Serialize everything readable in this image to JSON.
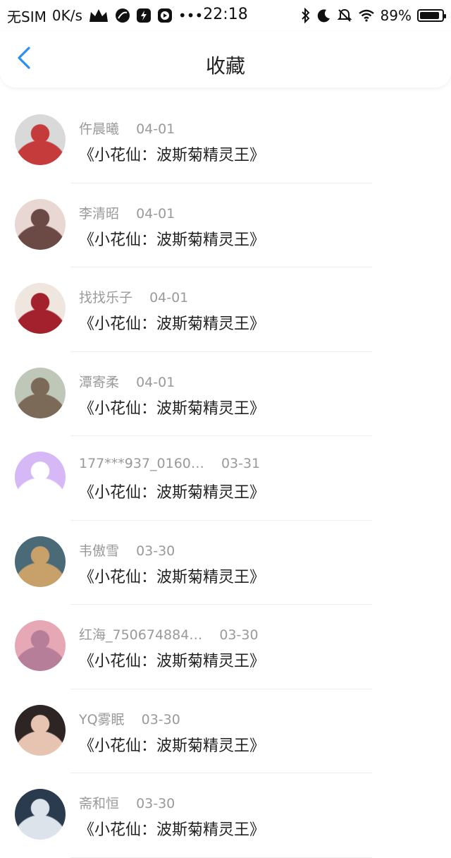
{
  "status": {
    "sim": "无SIM",
    "speed": "0K/s",
    "dots": "•••",
    "time": "22:18",
    "battery_percent": "89%",
    "battery_level": 0.89,
    "icons": [
      "crown-icon",
      "leaf-icon",
      "flash-icon",
      "play-icon",
      "bluetooth-icon",
      "moon-icon",
      "bell-off-icon",
      "wifi-icon",
      "battery-icon"
    ]
  },
  "nav": {
    "title": "收藏",
    "back_icon": "chevron-left-icon"
  },
  "items": [
    {
      "name": "仵晨曦",
      "date": "04-01",
      "title": "《小花仙：波斯菊精灵王》",
      "avatar_colors": [
        "#d9d9d9",
        "#c53b3b"
      ]
    },
    {
      "name": "李清昭",
      "date": "04-01",
      "title": "《小花仙：波斯菊精灵王》",
      "avatar_colors": [
        "#e9d7d3",
        "#6b4a45"
      ]
    },
    {
      "name": "找找乐子",
      "date": "04-01",
      "title": "《小花仙：波斯菊精灵王》",
      "avatar_colors": [
        "#f0e6e0",
        "#a2212c"
      ]
    },
    {
      "name": "潭寄柔",
      "date": "04-01",
      "title": "《小花仙：波斯菊精灵王》",
      "avatar_colors": [
        "#bfc7b8",
        "#7b6a58"
      ]
    },
    {
      "name": "177***937_0160…",
      "date": "03-31",
      "title": "《小花仙：波斯菊精灵王》",
      "avatar_colors": [
        "#d6b8f7",
        "#ffffff"
      ]
    },
    {
      "name": "韦傲雪",
      "date": "03-30",
      "title": "《小花仙：波斯菊精灵王》",
      "avatar_colors": [
        "#4a6a78",
        "#c7a06a"
      ]
    },
    {
      "name": "红海_750674884…",
      "date": "03-30",
      "title": "《小花仙：波斯菊精灵王》",
      "avatar_colors": [
        "#e7a8b5",
        "#b67e98"
      ]
    },
    {
      "name": "YQ雾眠",
      "date": "03-30",
      "title": "《小花仙：波斯菊精灵王》",
      "avatar_colors": [
        "#2d2424",
        "#e7c4b1"
      ]
    },
    {
      "name": "斋和恒",
      "date": "03-30",
      "title": "《小花仙：波斯菊精灵王》",
      "avatar_colors": [
        "#2a3b4e",
        "#dde3ea"
      ]
    }
  ]
}
